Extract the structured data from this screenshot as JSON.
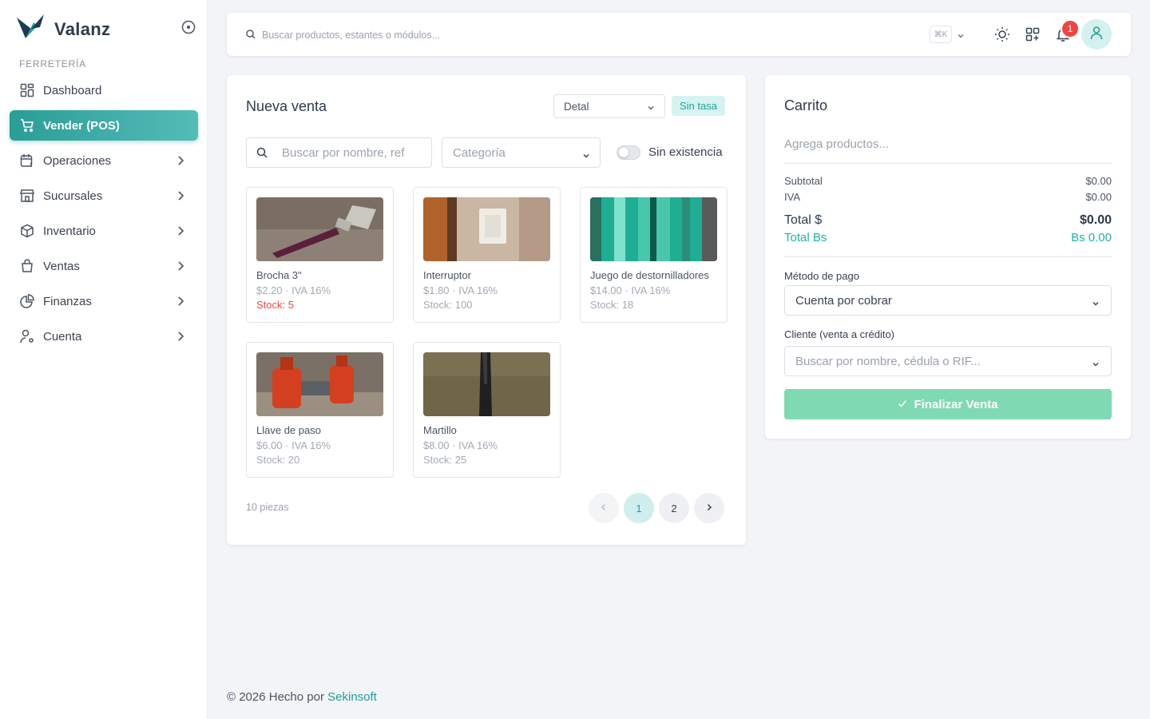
{
  "brand": {
    "name": "Valanz"
  },
  "sidebar": {
    "section": "FERRETERÍA",
    "items": [
      {
        "label": "Dashboard",
        "icon": "grid-icon"
      },
      {
        "label": "Vender (POS)",
        "icon": "cart-icon",
        "active": true
      },
      {
        "label": "Operaciones",
        "icon": "calendar-dollar-icon"
      },
      {
        "label": "Sucursales",
        "icon": "store-icon"
      },
      {
        "label": "Inventario",
        "icon": "box-icon"
      },
      {
        "label": "Ventas",
        "icon": "shopping-bag-icon"
      },
      {
        "label": "Finanzas",
        "icon": "pie-chart-icon"
      },
      {
        "label": "Cuenta",
        "icon": "user-settings-icon"
      }
    ]
  },
  "topbar": {
    "search_placeholder": "Buscar productos, estantes o módulos...",
    "shortcut": "⌘K",
    "notifications": "1"
  },
  "sale": {
    "title": "Nueva venta",
    "price_type": "Detal",
    "rate_badge": "Sin tasa",
    "search_placeholder": "Buscar por nombre, ref",
    "category_placeholder": "Categoría",
    "toggle_label": "Sin existencia",
    "products": [
      {
        "name": "Brocha 3\"",
        "price": "$2.20 · IVA 16%",
        "stock": "Stock: 5",
        "low": true
      },
      {
        "name": "Interruptor",
        "price": "$1.80 · IVA 16%",
        "stock": "Stock: 100"
      },
      {
        "name": "Juego de destornilladores",
        "price": "$14.00 · IVA 16%",
        "stock": "Stock: 18"
      },
      {
        "name": "Llave de paso",
        "price": "$6.00 · IVA 16%",
        "stock": "Stock: 20"
      },
      {
        "name": "Martillo",
        "price": "$8.00 · IVA 16%",
        "stock": "Stock: 25"
      }
    ],
    "pieces": "10 piezas",
    "pages": [
      "1",
      "2"
    ],
    "current_page": "1"
  },
  "cart": {
    "title": "Carrito",
    "empty": "Agrega productos...",
    "subtotal_label": "Subtotal",
    "subtotal": "$0.00",
    "iva_label": "IVA",
    "iva": "$0.00",
    "total_label": "Total $",
    "total": "$0.00",
    "total_bs_label": "Total Bs",
    "total_bs": "Bs 0.00",
    "payment_label": "Método de pago",
    "payment_value": "Cuenta por cobrar",
    "client_label": "Cliente (venta a crédito)",
    "client_placeholder": "Buscar por nombre, cédula o RIF...",
    "finalize": "Finalizar Venta"
  },
  "footer": {
    "prefix": "© 2026 Hecho por",
    "link": "Sekinsoft"
  },
  "colors": {
    "accent": "#2a9d97",
    "finalize": "#7fd9b3",
    "danger": "#ef4444"
  }
}
